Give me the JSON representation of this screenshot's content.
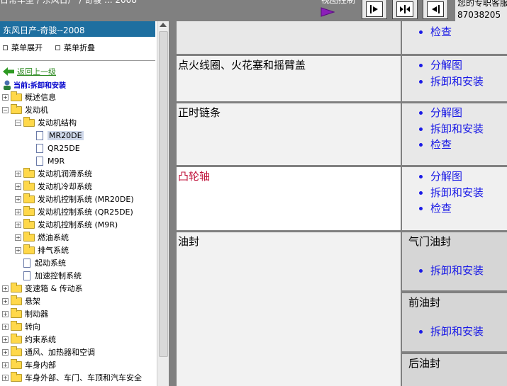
{
  "topbar": {
    "breadcrumb": "日常车型 / 东风日产 / 奇骏 ... 2008",
    "view_control_label": "视图控制",
    "help_line": "您的专职客服",
    "phone": "87038205"
  },
  "sidebar": {
    "brand": "东风日产-奇骏--2008",
    "expand_label": "菜单展开",
    "collapse_label": "菜单折叠",
    "back_label": "返回上一级",
    "current_label": "当前:拆卸和安装",
    "tree": [
      {
        "label": "概述信息",
        "level": 0,
        "type": "folder",
        "sign": "+"
      },
      {
        "label": "发动机",
        "level": 0,
        "type": "folder",
        "sign": "-"
      },
      {
        "label": "发动机结构",
        "level": 1,
        "type": "folder",
        "sign": "-"
      },
      {
        "label": "MR20DE",
        "level": 2,
        "type": "doc",
        "selected": true
      },
      {
        "label": "QR25DE",
        "level": 2,
        "type": "doc"
      },
      {
        "label": "M9R",
        "level": 2,
        "type": "doc"
      },
      {
        "label": "发动机润滑系统",
        "level": 1,
        "type": "folder",
        "sign": "+"
      },
      {
        "label": "发动机冷却系统",
        "level": 1,
        "type": "folder",
        "sign": "+"
      },
      {
        "label": "发动机控制系统 (MR20DE)",
        "level": 1,
        "type": "folder",
        "sign": "+"
      },
      {
        "label": "发动机控制系统 (QR25DE)",
        "level": 1,
        "type": "folder",
        "sign": "+"
      },
      {
        "label": "发动机控制系统 (M9R)",
        "level": 1,
        "type": "folder",
        "sign": "+"
      },
      {
        "label": "燃油系统",
        "level": 1,
        "type": "folder",
        "sign": "+"
      },
      {
        "label": "排气系统",
        "level": 1,
        "type": "folder",
        "sign": "+"
      },
      {
        "label": "起动系统",
        "level": 1,
        "type": "doc"
      },
      {
        "label": "加速控制系统",
        "level": 1,
        "type": "doc"
      },
      {
        "label": "变速箱 & 传动系",
        "level": 0,
        "type": "folder",
        "sign": "+"
      },
      {
        "label": "悬架",
        "level": 0,
        "type": "folder",
        "sign": "+"
      },
      {
        "label": "制动器",
        "level": 0,
        "type": "folder",
        "sign": "+"
      },
      {
        "label": "转向",
        "level": 0,
        "type": "folder",
        "sign": "+"
      },
      {
        "label": "约束系统",
        "level": 0,
        "type": "folder",
        "sign": "+"
      },
      {
        "label": "通风、加热器和空调",
        "level": 0,
        "type": "folder",
        "sign": "+"
      },
      {
        "label": "车身内部",
        "level": 0,
        "type": "folder",
        "sign": "+"
      },
      {
        "label": "车身外部、车门、车顶和汽车安全",
        "level": 0,
        "type": "folder",
        "sign": "+"
      }
    ]
  },
  "content": {
    "rows": [
      {
        "name": "",
        "links": [
          "检查"
        ]
      },
      {
        "name": "点火线圈、火花塞和摇臂盖",
        "links": [
          "分解图",
          "拆卸和安装"
        ]
      },
      {
        "name": "正时链条",
        "links": [
          "分解图",
          "拆卸和安装",
          "检查"
        ]
      },
      {
        "name": "凸轮轴",
        "links": [
          "分解图",
          "拆卸和安装",
          "检查"
        ],
        "highlight": true
      },
      {
        "name": "油封",
        "subs": [
          {
            "title": "气门油封",
            "links": [
              "拆卸和安装"
            ]
          },
          {
            "title": "前油封",
            "links": [
              "拆卸和安装"
            ]
          },
          {
            "title": "后油封",
            "links": []
          }
        ]
      }
    ]
  },
  "colors": {
    "accent": "#1e6fa0",
    "link": "#1a1ae6",
    "highlight_text": "#c0143c",
    "back_link": "#2e8b22"
  }
}
